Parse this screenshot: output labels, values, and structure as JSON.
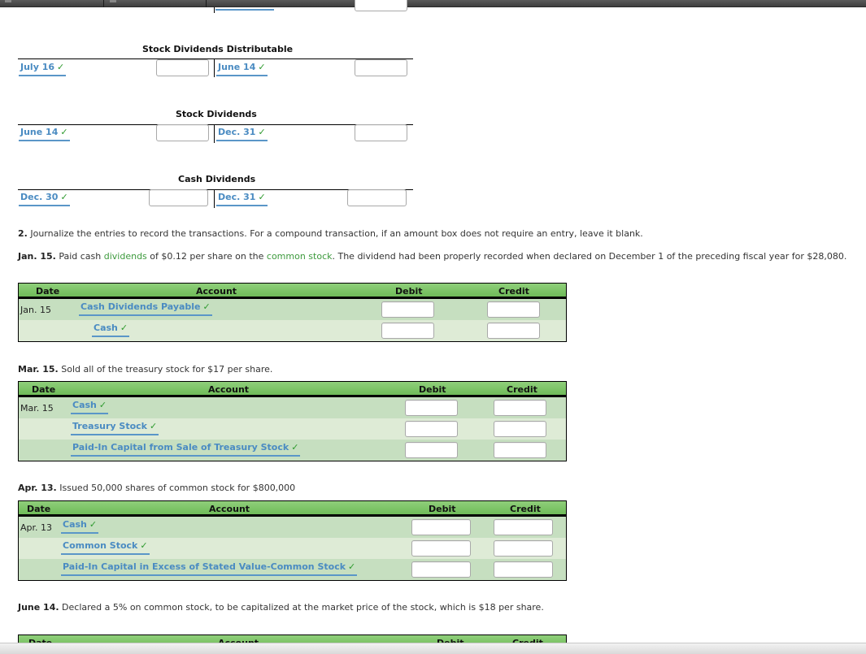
{
  "t_accounts": [
    {
      "title": "Stock Dividends Distributable",
      "debit_date": "July 16",
      "credit_date": "June 14"
    },
    {
      "title": "Stock Dividends",
      "debit_date": "June 14",
      "credit_date": "Dec. 31"
    },
    {
      "title": "Cash Dividends",
      "debit_date": "Dec. 30",
      "credit_date": "Dec. 31"
    }
  ],
  "check_mark": "✓",
  "instruction": {
    "number": "2.",
    "text": " Journalize the entries to record the transactions. For a compound transaction, if an amount box does not require an entry, leave it blank."
  },
  "column_headers": {
    "date": "Date",
    "account": "Account",
    "debit": "Debit",
    "credit": "Credit"
  },
  "transactions": [
    {
      "label": "Jan. 15.",
      "text_parts": [
        {
          "text": "  Paid cash ",
          "style": "normal"
        },
        {
          "text": "dividends",
          "style": "green"
        },
        {
          "text": " of $0.12 per share on the ",
          "style": "normal"
        },
        {
          "text": "common stock",
          "style": "green"
        },
        {
          "text": ". The dividend had been properly recorded when declared on December 1 of the preceding fiscal year for $28,080.",
          "style": "normal"
        }
      ],
      "date": "Jan. 15",
      "rows": [
        {
          "account": "Cash Dividends Payable",
          "debit": "",
          "credit": ""
        },
        {
          "account": "Cash",
          "debit": "",
          "credit": ""
        }
      ]
    },
    {
      "label": "Mar. 15.",
      "text": " Sold all of the treasury stock for $17 per share.",
      "date": "Mar. 15",
      "rows": [
        {
          "account": "Cash",
          "debit": "",
          "credit": ""
        },
        {
          "account": "Treasury Stock",
          "debit": "",
          "credit": ""
        },
        {
          "account": "Paid-In Capital from Sale of Treasury Stock",
          "debit": "",
          "credit": ""
        }
      ]
    },
    {
      "label": "Apr. 13.",
      "text": " Issued 50,000 shares of common stock for $800,000",
      "date": "Apr. 13",
      "rows": [
        {
          "account": "Cash",
          "debit": "",
          "credit": ""
        },
        {
          "account": "Common Stock",
          "debit": "",
          "credit": ""
        },
        {
          "account": "Paid-In Capital in Excess of Stated Value-Common Stock",
          "debit": "",
          "credit": ""
        }
      ]
    },
    {
      "label": "June 14.",
      "text": " Declared a 5% on common stock, to be capitalized at the market price of the stock, which is $18 per share."
    }
  ]
}
